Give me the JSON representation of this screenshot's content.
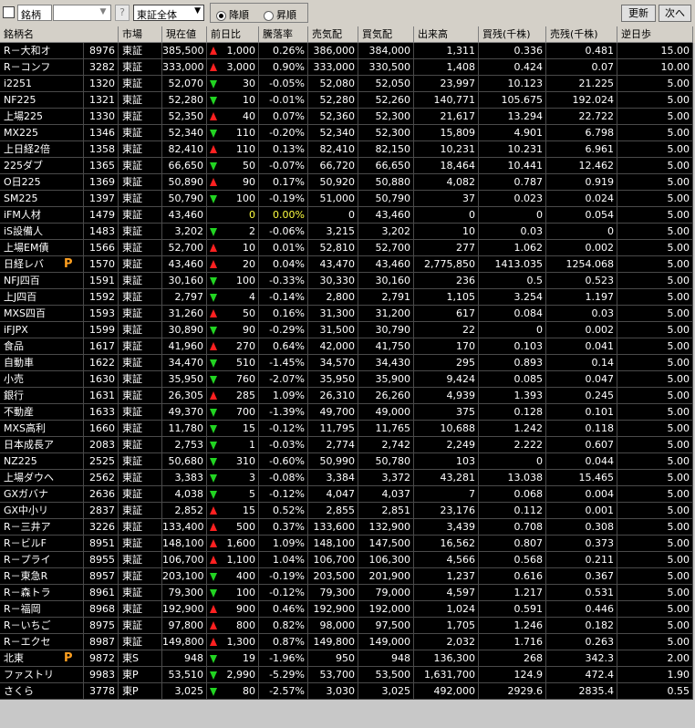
{
  "toolbar": {
    "code_label": "銘柄",
    "code_value": "",
    "question": "?",
    "market_select": "東証全体",
    "sort_desc": "降順",
    "sort_asc": "昇順",
    "sort_selected": "desc",
    "refresh": "更新",
    "next": "次へ"
  },
  "columns": [
    "銘柄名",
    "市場",
    "現在値",
    "前日比",
    "騰落率",
    "売気配",
    "買気配",
    "出来高",
    "買残(千株)",
    "売残(千株)",
    "逆日歩"
  ],
  "rows": [
    {
      "name": "R－大和オ",
      "code": "8976",
      "market": "東証",
      "price": "385,500",
      "dir": "up",
      "change": "1,000",
      "rate": "0.26%",
      "ask": "386,000",
      "bid": "384,000",
      "volume": "1,311",
      "buy": "0.336",
      "sell": "0.481",
      "gyaku": "15.00",
      "p": false
    },
    {
      "name": "R－コンフ",
      "code": "3282",
      "market": "東証",
      "price": "333,000",
      "dir": "up",
      "change": "3,000",
      "rate": "0.90%",
      "ask": "333,000",
      "bid": "330,500",
      "volume": "1,408",
      "buy": "0.424",
      "sell": "0.07",
      "gyaku": "10.00",
      "p": false
    },
    {
      "name": "i2251",
      "code": "1320",
      "market": "東証",
      "price": "52,070",
      "dir": "dn",
      "change": "30",
      "rate": "-0.05%",
      "ask": "52,080",
      "bid": "52,050",
      "volume": "23,997",
      "buy": "10.123",
      "sell": "21.225",
      "gyaku": "5.00",
      "p": false
    },
    {
      "name": "NF225",
      "code": "1321",
      "market": "東証",
      "price": "52,280",
      "dir": "dn",
      "change": "10",
      "rate": "-0.01%",
      "ask": "52,280",
      "bid": "52,260",
      "volume": "140,771",
      "buy": "105.675",
      "sell": "192.024",
      "gyaku": "5.00",
      "p": false
    },
    {
      "name": "上場225",
      "code": "1330",
      "market": "東証",
      "price": "52,350",
      "dir": "up",
      "change": "40",
      "rate": "0.07%",
      "ask": "52,360",
      "bid": "52,300",
      "volume": "21,617",
      "buy": "13.294",
      "sell": "22.722",
      "gyaku": "5.00",
      "p": false
    },
    {
      "name": "MX225",
      "code": "1346",
      "market": "東証",
      "price": "52,340",
      "dir": "dn",
      "change": "110",
      "rate": "-0.20%",
      "ask": "52,340",
      "bid": "52,300",
      "volume": "15,809",
      "buy": "4.901",
      "sell": "6.798",
      "gyaku": "5.00",
      "p": false
    },
    {
      "name": "上日経2倍",
      "code": "1358",
      "market": "東証",
      "price": "82,410",
      "dir": "up",
      "change": "110",
      "rate": "0.13%",
      "ask": "82,410",
      "bid": "82,150",
      "volume": "10,231",
      "buy": "10.231",
      "sell": "6.961",
      "gyaku": "5.00",
      "p": false
    },
    {
      "name": "225ダブ",
      "code": "1365",
      "market": "東証",
      "price": "66,650",
      "dir": "dn",
      "change": "50",
      "rate": "-0.07%",
      "ask": "66,720",
      "bid": "66,650",
      "volume": "18,464",
      "buy": "10.441",
      "sell": "12.462",
      "gyaku": "5.00",
      "p": false
    },
    {
      "name": "O日225",
      "code": "1369",
      "market": "東証",
      "price": "50,890",
      "dir": "up",
      "change": "90",
      "rate": "0.17%",
      "ask": "50,920",
      "bid": "50,880",
      "volume": "4,082",
      "buy": "0.787",
      "sell": "0.919",
      "gyaku": "5.00",
      "p": false
    },
    {
      "name": "SM225",
      "code": "1397",
      "market": "東証",
      "price": "50,790",
      "dir": "dn",
      "change": "100",
      "rate": "-0.19%",
      "ask": "51,000",
      "bid": "50,790",
      "volume": "37",
      "buy": "0.023",
      "sell": "0.024",
      "gyaku": "5.00",
      "p": false
    },
    {
      "name": "iFM人材",
      "code": "1479",
      "market": "東証",
      "price": "43,460",
      "dir": "flat",
      "change": "0",
      "rate": "0.00%",
      "ask": "0",
      "bid": "43,460",
      "volume": "0",
      "buy": "0",
      "sell": "0.054",
      "gyaku": "5.00",
      "p": false
    },
    {
      "name": "iS設備人",
      "code": "1483",
      "market": "東証",
      "price": "3,202",
      "dir": "dn",
      "change": "2",
      "rate": "-0.06%",
      "ask": "3,215",
      "bid": "3,202",
      "volume": "10",
      "buy": "0.03",
      "sell": "0",
      "gyaku": "5.00",
      "p": false
    },
    {
      "name": "上場EM債",
      "code": "1566",
      "market": "東証",
      "price": "52,700",
      "dir": "up",
      "change": "10",
      "rate": "0.01%",
      "ask": "52,810",
      "bid": "52,700",
      "volume": "277",
      "buy": "1.062",
      "sell": "0.002",
      "gyaku": "5.00",
      "p": false
    },
    {
      "name": "日経レバ",
      "code": "1570",
      "market": "東証",
      "price": "43,460",
      "dir": "up",
      "change": "20",
      "rate": "0.04%",
      "ask": "43,470",
      "bid": "43,460",
      "volume": "2,775,850",
      "buy": "1413.035",
      "sell": "1254.068",
      "gyaku": "5.00",
      "p": true
    },
    {
      "name": "NFJ四百",
      "code": "1591",
      "market": "東証",
      "price": "30,160",
      "dir": "dn",
      "change": "100",
      "rate": "-0.33%",
      "ask": "30,330",
      "bid": "30,160",
      "volume": "236",
      "buy": "0.5",
      "sell": "0.523",
      "gyaku": "5.00",
      "p": false
    },
    {
      "name": "上J四百",
      "code": "1592",
      "market": "東証",
      "price": "2,797",
      "dir": "dn",
      "change": "4",
      "rate": "-0.14%",
      "ask": "2,800",
      "bid": "2,791",
      "volume": "1,105",
      "buy": "3.254",
      "sell": "1.197",
      "gyaku": "5.00",
      "p": false
    },
    {
      "name": "MXS四百",
      "code": "1593",
      "market": "東証",
      "price": "31,260",
      "dir": "up",
      "change": "50",
      "rate": "0.16%",
      "ask": "31,300",
      "bid": "31,200",
      "volume": "617",
      "buy": "0.084",
      "sell": "0.03",
      "gyaku": "5.00",
      "p": false
    },
    {
      "name": "iFJPX",
      "code": "1599",
      "market": "東証",
      "price": "30,890",
      "dir": "dn",
      "change": "90",
      "rate": "-0.29%",
      "ask": "31,500",
      "bid": "30,790",
      "volume": "22",
      "buy": "0",
      "sell": "0.002",
      "gyaku": "5.00",
      "p": false
    },
    {
      "name": "食品",
      "code": "1617",
      "market": "東証",
      "price": "41,960",
      "dir": "up",
      "change": "270",
      "rate": "0.64%",
      "ask": "42,000",
      "bid": "41,750",
      "volume": "170",
      "buy": "0.103",
      "sell": "0.041",
      "gyaku": "5.00",
      "p": false
    },
    {
      "name": "自動車",
      "code": "1622",
      "market": "東証",
      "price": "34,470",
      "dir": "dn",
      "change": "510",
      "rate": "-1.45%",
      "ask": "34,570",
      "bid": "34,430",
      "volume": "295",
      "buy": "0.893",
      "sell": "0.14",
      "gyaku": "5.00",
      "p": false
    },
    {
      "name": "小売",
      "code": "1630",
      "market": "東証",
      "price": "35,950",
      "dir": "dn",
      "change": "760",
      "rate": "-2.07%",
      "ask": "35,950",
      "bid": "35,900",
      "volume": "9,424",
      "buy": "0.085",
      "sell": "0.047",
      "gyaku": "5.00",
      "p": false
    },
    {
      "name": "銀行",
      "code": "1631",
      "market": "東証",
      "price": "26,305",
      "dir": "up",
      "change": "285",
      "rate": "1.09%",
      "ask": "26,310",
      "bid": "26,260",
      "volume": "4,939",
      "buy": "1.393",
      "sell": "0.245",
      "gyaku": "5.00",
      "p": false
    },
    {
      "name": "不動産",
      "code": "1633",
      "market": "東証",
      "price": "49,370",
      "dir": "dn",
      "change": "700",
      "rate": "-1.39%",
      "ask": "49,700",
      "bid": "49,000",
      "volume": "375",
      "buy": "0.128",
      "sell": "0.101",
      "gyaku": "5.00",
      "p": false
    },
    {
      "name": "MXS高利",
      "code": "1660",
      "market": "東証",
      "price": "11,780",
      "dir": "dn",
      "change": "15",
      "rate": "-0.12%",
      "ask": "11,795",
      "bid": "11,765",
      "volume": "10,688",
      "buy": "1.242",
      "sell": "0.118",
      "gyaku": "5.00",
      "p": false
    },
    {
      "name": "日本成長ア",
      "code": "2083",
      "market": "東証",
      "price": "2,753",
      "dir": "dn",
      "change": "1",
      "rate": "-0.03%",
      "ask": "2,774",
      "bid": "2,742",
      "volume": "2,249",
      "buy": "2.222",
      "sell": "0.607",
      "gyaku": "5.00",
      "p": false
    },
    {
      "name": "NZ225",
      "code": "2525",
      "market": "東証",
      "price": "50,680",
      "dir": "dn",
      "change": "310",
      "rate": "-0.60%",
      "ask": "50,990",
      "bid": "50,780",
      "volume": "103",
      "buy": "0",
      "sell": "0.044",
      "gyaku": "5.00",
      "p": false
    },
    {
      "name": "上場ダウヘ",
      "code": "2562",
      "market": "東証",
      "price": "3,383",
      "dir": "dn",
      "change": "3",
      "rate": "-0.08%",
      "ask": "3,384",
      "bid": "3,372",
      "volume": "43,281",
      "buy": "13.038",
      "sell": "15.465",
      "gyaku": "5.00",
      "p": false
    },
    {
      "name": "GXガバナ",
      "code": "2636",
      "market": "東証",
      "price": "4,038",
      "dir": "dn",
      "change": "5",
      "rate": "-0.12%",
      "ask": "4,047",
      "bid": "4,037",
      "volume": "7",
      "buy": "0.068",
      "sell": "0.004",
      "gyaku": "5.00",
      "p": false
    },
    {
      "name": "GX中小リ",
      "code": "2837",
      "market": "東証",
      "price": "2,852",
      "dir": "up",
      "change": "15",
      "rate": "0.52%",
      "ask": "2,855",
      "bid": "2,851",
      "volume": "23,176",
      "buy": "0.112",
      "sell": "0.001",
      "gyaku": "5.00",
      "p": false
    },
    {
      "name": "R－三井ア",
      "code": "3226",
      "market": "東証",
      "price": "133,400",
      "dir": "up",
      "change": "500",
      "rate": "0.37%",
      "ask": "133,600",
      "bid": "132,900",
      "volume": "3,439",
      "buy": "0.708",
      "sell": "0.308",
      "gyaku": "5.00",
      "p": false
    },
    {
      "name": "R－ビルF",
      "code": "8951",
      "market": "東証",
      "price": "148,100",
      "dir": "up",
      "change": "1,600",
      "rate": "1.09%",
      "ask": "148,100",
      "bid": "147,500",
      "volume": "16,562",
      "buy": "0.807",
      "sell": "0.373",
      "gyaku": "5.00",
      "p": false
    },
    {
      "name": "R－プライ",
      "code": "8955",
      "market": "東証",
      "price": "106,700",
      "dir": "up",
      "change": "1,100",
      "rate": "1.04%",
      "ask": "106,700",
      "bid": "106,300",
      "volume": "4,566",
      "buy": "0.568",
      "sell": "0.211",
      "gyaku": "5.00",
      "p": false
    },
    {
      "name": "R－東急R",
      "code": "8957",
      "market": "東証",
      "price": "203,100",
      "dir": "dn",
      "change": "400",
      "rate": "-0.19%",
      "ask": "203,500",
      "bid": "201,900",
      "volume": "1,237",
      "buy": "0.616",
      "sell": "0.367",
      "gyaku": "5.00",
      "p": false
    },
    {
      "name": "R－森トラ",
      "code": "8961",
      "market": "東証",
      "price": "79,300",
      "dir": "dn",
      "change": "100",
      "rate": "-0.12%",
      "ask": "79,300",
      "bid": "79,000",
      "volume": "4,597",
      "buy": "1.217",
      "sell": "0.531",
      "gyaku": "5.00",
      "p": false
    },
    {
      "name": "R－福岡",
      "code": "8968",
      "market": "東証",
      "price": "192,900",
      "dir": "up",
      "change": "900",
      "rate": "0.46%",
      "ask": "192,900",
      "bid": "192,000",
      "volume": "1,024",
      "buy": "0.591",
      "sell": "0.446",
      "gyaku": "5.00",
      "p": false
    },
    {
      "name": "R－いちご",
      "code": "8975",
      "market": "東証",
      "price": "97,800",
      "dir": "up",
      "change": "800",
      "rate": "0.82%",
      "ask": "98,000",
      "bid": "97,500",
      "volume": "1,705",
      "buy": "1.246",
      "sell": "0.182",
      "gyaku": "5.00",
      "p": false
    },
    {
      "name": "R－エクセ",
      "code": "8987",
      "market": "東証",
      "price": "149,800",
      "dir": "up",
      "change": "1,300",
      "rate": "0.87%",
      "ask": "149,800",
      "bid": "149,000",
      "volume": "2,032",
      "buy": "1.716",
      "sell": "0.263",
      "gyaku": "5.00",
      "p": false
    },
    {
      "name": "北東",
      "code": "9872",
      "market": "東S",
      "price": "948",
      "dir": "dn",
      "change": "19",
      "rate": "-1.96%",
      "ask": "950",
      "bid": "948",
      "volume": "136,300",
      "buy": "268",
      "sell": "342.3",
      "gyaku": "2.00",
      "p": true
    },
    {
      "name": "ファストリ",
      "code": "9983",
      "market": "東P",
      "price": "53,510",
      "dir": "dn",
      "change": "2,990",
      "rate": "-5.29%",
      "ask": "53,700",
      "bid": "53,500",
      "volume": "1,631,700",
      "buy": "124.9",
      "sell": "472.4",
      "gyaku": "1.90",
      "p": false
    },
    {
      "name": "さくら",
      "code": "3778",
      "market": "東P",
      "price": "3,025",
      "dir": "dn",
      "change": "80",
      "rate": "-2.57%",
      "ask": "3,030",
      "bid": "3,025",
      "volume": "492,000",
      "buy": "2929.6",
      "sell": "2835.4",
      "gyaku": "0.55",
      "p": false
    }
  ],
  "colors": {
    "up": "#ff2020",
    "down": "#22d422",
    "p_badge": "#ffa020"
  }
}
